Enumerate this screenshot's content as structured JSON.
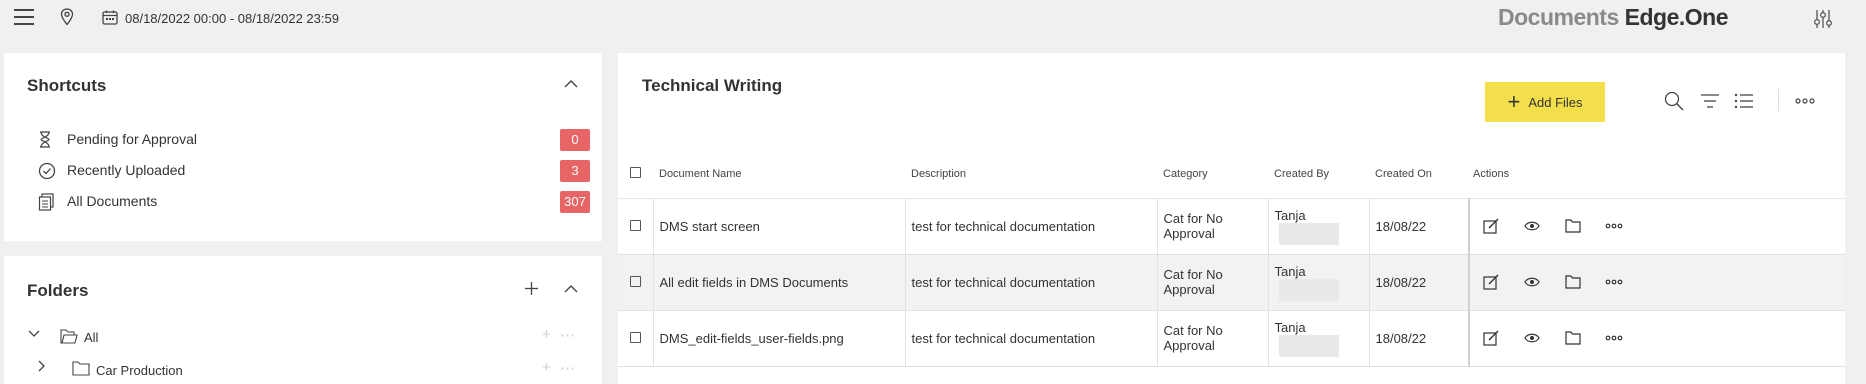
{
  "header": {
    "date_range": "08/18/2022 00:00 - 08/18/2022 23:59",
    "logo_part1": "Documents",
    "logo_part2": "Edge.One"
  },
  "shortcuts": {
    "title": "Shortcuts",
    "items": [
      {
        "label": "Pending for Approval",
        "count": "0",
        "icon": "hourglass-icon"
      },
      {
        "label": "Recently Uploaded",
        "count": "3",
        "icon": "check-circle-icon"
      },
      {
        "label": "All Documents",
        "count": "307",
        "icon": "documents-icon"
      }
    ]
  },
  "folders": {
    "title": "Folders",
    "items": [
      {
        "label": "All"
      },
      {
        "label": "Car Production"
      }
    ]
  },
  "main": {
    "title": "Technical Writing",
    "add_files_label": "Add Files",
    "columns": [
      "Document Name",
      "Description",
      "Category",
      "Created By",
      "Created On",
      "Actions"
    ],
    "rows": [
      {
        "name": "DMS start screen",
        "description": "test for technical documentation",
        "category": "Cat for No Approval",
        "created_by": "Tanja",
        "created_on": "18/08/22"
      },
      {
        "name": "All edit fields in DMS Documents",
        "description": "test for technical documentation",
        "category": "Cat for No Approval",
        "created_by": "Tanja",
        "created_on": "18/08/22"
      },
      {
        "name": "DMS_edit-fields_user-fields.png",
        "description": "test for technical documentation",
        "category": "Cat for No Approval",
        "created_by": "Tanja",
        "created_on": "18/08/22"
      }
    ]
  },
  "colors": {
    "badge": "#e86566",
    "add_button": "#f3df4b",
    "background": "#f0f0f0"
  }
}
